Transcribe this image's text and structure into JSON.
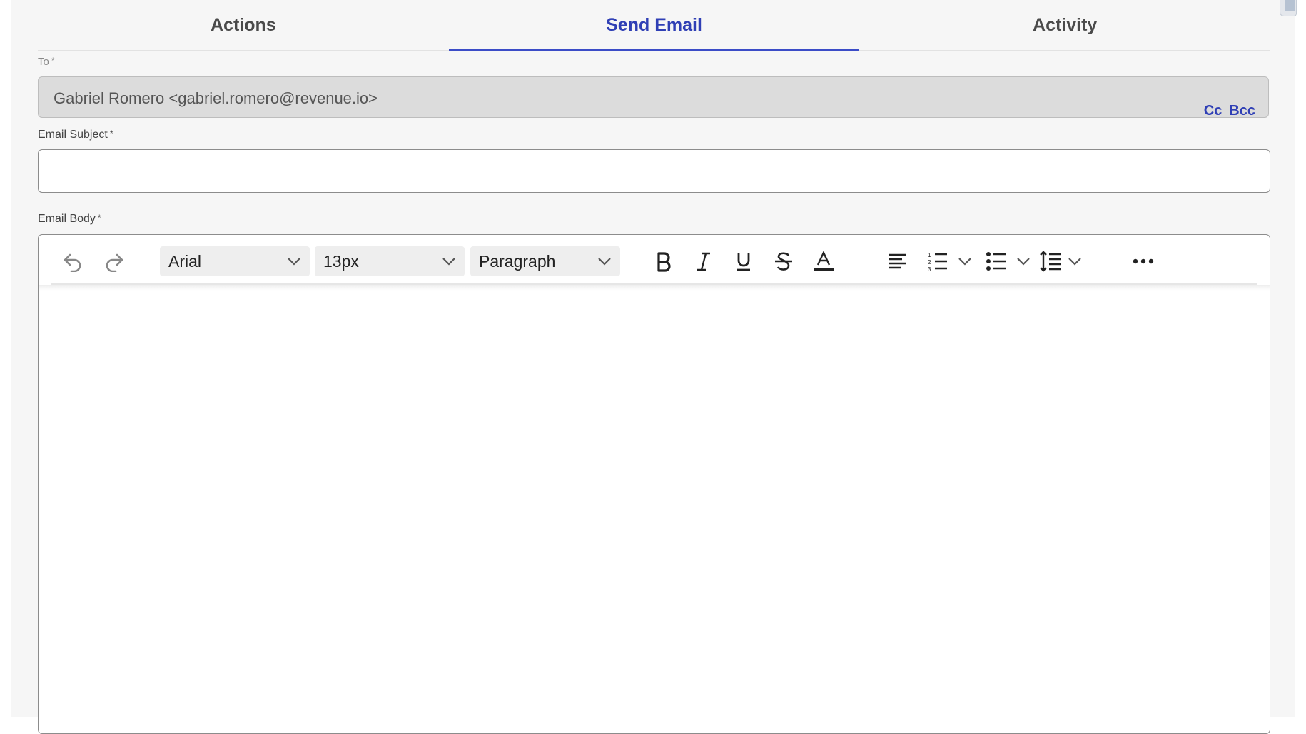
{
  "tabs": [
    {
      "label": "Actions",
      "active": false
    },
    {
      "label": "Send Email",
      "active": true
    },
    {
      "label": "Activity",
      "active": false
    }
  ],
  "to": {
    "label": "To",
    "required_mark": "*",
    "value": "Gabriel Romero <gabriel.romero@revenue.io>",
    "cc_label": "Cc",
    "bcc_label": "Bcc"
  },
  "subject": {
    "label": "Email Subject",
    "required_mark": "*",
    "value": ""
  },
  "body": {
    "label": "Email Body",
    "required_mark": "*",
    "toolbar": {
      "font_family": "Arial",
      "font_size": "13px",
      "block_format": "Paragraph",
      "icons": [
        "undo-icon",
        "redo-icon",
        "bold-icon",
        "italic-icon",
        "underline-icon",
        "strikethrough-icon",
        "text-color-icon",
        "align-left-icon",
        "numbered-list-icon",
        "bullet-list-icon",
        "line-height-icon",
        "more-icon"
      ]
    },
    "content": ""
  },
  "colors": {
    "accent": "#2f3fb5",
    "panel_bg": "#f6f6f6",
    "readonly_field_bg": "#dcdcdc"
  }
}
